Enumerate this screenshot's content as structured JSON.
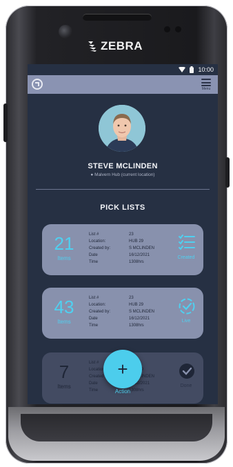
{
  "device": {
    "brand": "ZEBRA"
  },
  "status_bar": {
    "time": "10:00"
  },
  "app_bar": {
    "menu_label": "Menu"
  },
  "profile": {
    "name": "STEVE MCLINDEN",
    "location": "Malvern Hub (current location)"
  },
  "section": {
    "title": "PICK LISTS"
  },
  "pick_lists": [
    {
      "count": "21",
      "count_label": "Items",
      "rows": [
        {
          "label": "List #",
          "value": "23"
        },
        {
          "label": "Location:",
          "value": "HUB 29"
        },
        {
          "label": "Created by:",
          "value": "S MCLINDEN"
        },
        {
          "label": "Date",
          "value": "16/12/2021"
        },
        {
          "label": "Time",
          "value": "1308hrs"
        }
      ],
      "status_icon": "checklist-icon",
      "status": "Created"
    },
    {
      "count": "43",
      "count_label": "Items",
      "rows": [
        {
          "label": "List #",
          "value": "23"
        },
        {
          "label": "Location:",
          "value": "HUB 29"
        },
        {
          "label": "Created by:",
          "value": "S MCLINDEN"
        },
        {
          "label": "Date",
          "value": "16/12/2021"
        },
        {
          "label": "Time",
          "value": "1308hrs"
        }
      ],
      "status_icon": "check-circle-dashed-icon",
      "status": "Live"
    },
    {
      "count": "7",
      "count_label": "Items",
      "rows": [
        {
          "label": "List #",
          "value": "23"
        },
        {
          "label": "Location:",
          "value": "HUB 29"
        },
        {
          "label": "Created by:",
          "value": "S MCLINDEN"
        },
        {
          "label": "Date",
          "value": "16/12/2021"
        },
        {
          "label": "Time",
          "value": "1308hrs"
        }
      ],
      "status_icon": "check-circle-filled-icon",
      "status": "Done"
    }
  ],
  "fab": {
    "symbol": "+",
    "label": "Action"
  },
  "colors": {
    "screen_bg": "#263043",
    "app_bar": "#8a93b2",
    "card": "#8891ad",
    "accent": "#4fd0f0"
  }
}
